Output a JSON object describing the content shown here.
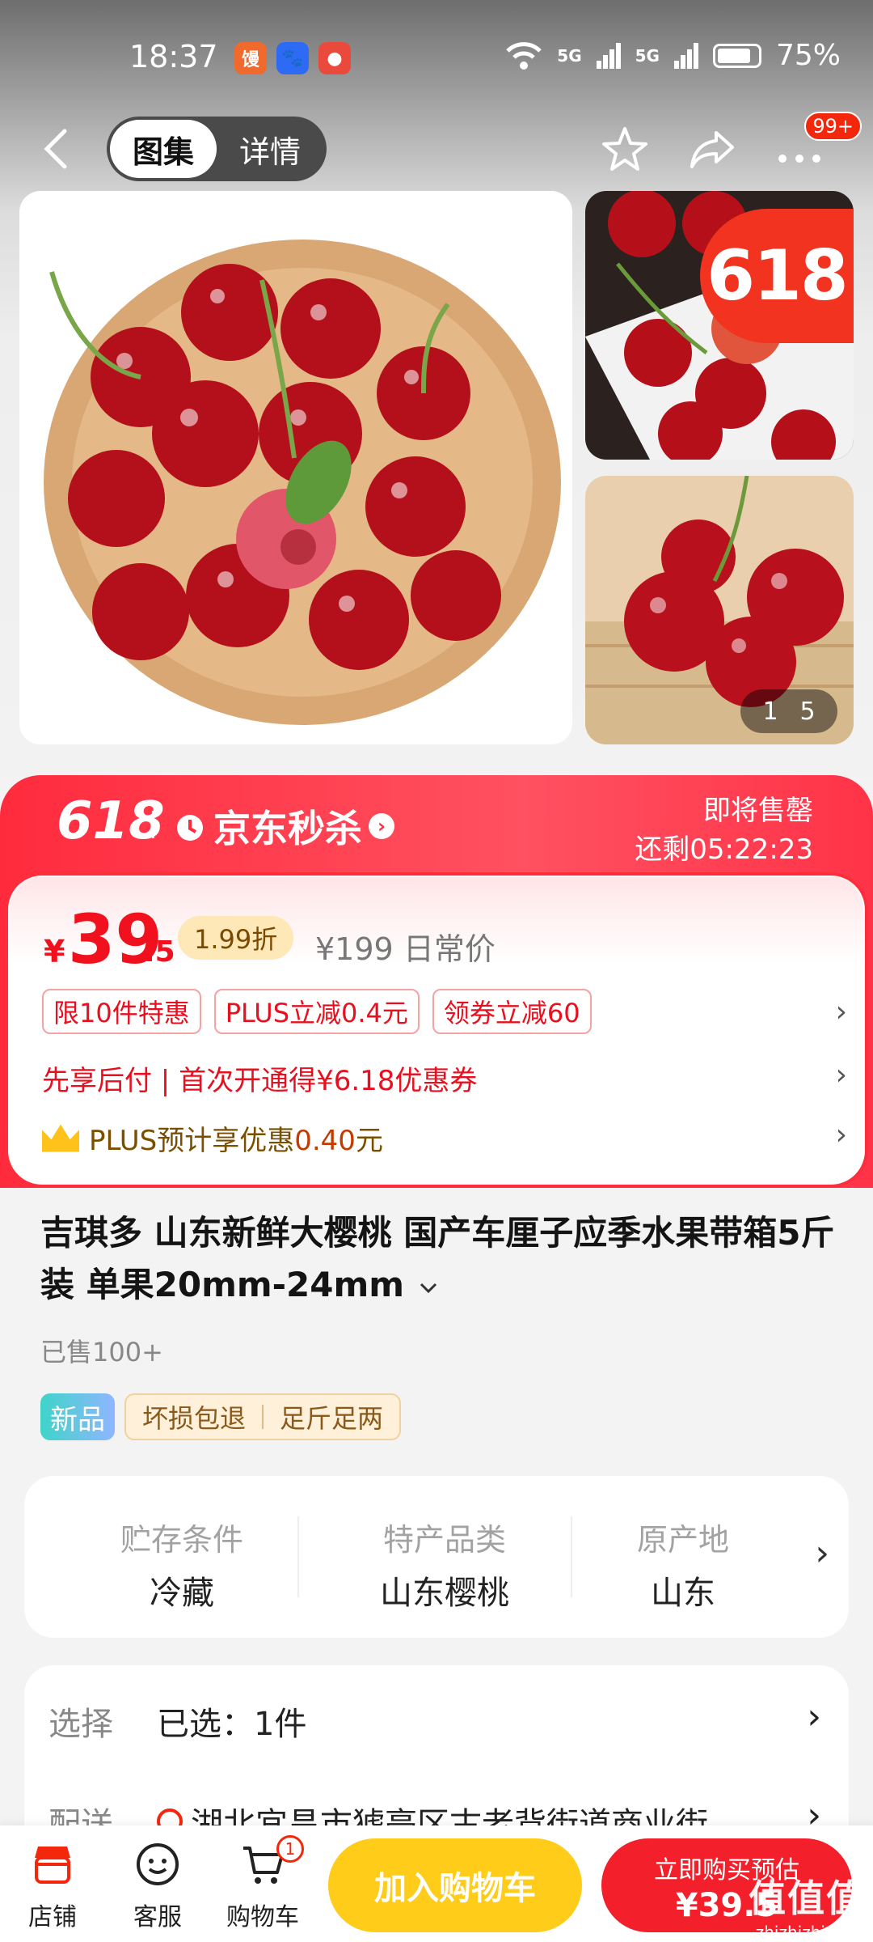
{
  "status_bar": {
    "time": "18:37",
    "battery": "75%",
    "signal_1": "5G",
    "signal_2": "5G"
  },
  "nav": {
    "tab_gallery": "图集",
    "tab_detail": "详情",
    "notification_count": "99+"
  },
  "gallery": {
    "promo_badge": "618",
    "page_current": "1",
    "page_total": "5"
  },
  "promo": {
    "event": "618",
    "brand": "京东秒杀",
    "arrow": "›",
    "stock_status": "即将售罄",
    "countdown_label": "还剩",
    "countdown": "05:22:23"
  },
  "price": {
    "symbol": "¥",
    "integer": "39",
    "decimal": ".5",
    "discount": "1.99折",
    "original": "¥199",
    "original_label": "日常价"
  },
  "promo_tags": [
    "限10件特惠",
    "PLUS立减0.4元",
    "领券立减60"
  ],
  "bnpl_text": "先享后付 | 首次开通得¥6.18优惠券",
  "plus": {
    "prefix": "PLUS预计享优惠",
    "amount": "0.40",
    "unit": "元"
  },
  "product": {
    "title": "吉琪多 山东新鲜大樱桃 国产车厘子应季水果带箱5斤装 单果20mm-24mm",
    "sold": "已售100+"
  },
  "badges": {
    "new": "新品",
    "service_1": "坏损包退",
    "service_2": "足斤足两"
  },
  "attributes": [
    {
      "key": "贮存条件",
      "value": "冷藏"
    },
    {
      "key": "特产品类",
      "value": "山东樱桃"
    },
    {
      "key": "原产地",
      "value": "山东"
    }
  ],
  "selection": {
    "label": "选择",
    "value": "已选：1件",
    "ship_label": "配送",
    "ship_value": "湖北宜昌市猇亭区古老背街道商业街"
  },
  "bottom_bar": {
    "store": "店铺",
    "service": "客服",
    "cart": "购物车",
    "cart_count": "1",
    "add_to_cart": "加入购物车",
    "buy_line1": "立即购买预估",
    "buy_line2": "¥39.5"
  },
  "watermark": {
    "brand": "值值值",
    "url": "zhizhizhi.com"
  },
  "colors": {
    "accent": "#f2270c",
    "promo_red": "#ff2b3d",
    "cart_yellow": "#ffcc1a"
  }
}
